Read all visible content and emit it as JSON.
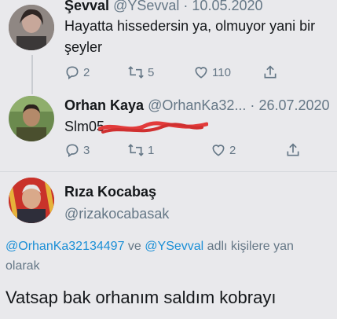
{
  "tweet1": {
    "name": "Şevval",
    "handle": "@YSevval",
    "separator": "·",
    "date": "10.05.2020",
    "text": "Hayatta hissedersin ya, olmuyor yani bir şeyler",
    "replies": "2",
    "retweets": "5",
    "likes": "110"
  },
  "tweet2": {
    "name": "Orhan Kaya",
    "handle": "@OrhanKa32...",
    "separator": "·",
    "date": "26.07.2020",
    "text_visible": "Slm05",
    "replies": "3",
    "retweets": "1",
    "likes": "2",
    "scribble_color": "#e23b3b"
  },
  "tweet3": {
    "name": "Rıza Kocabaş",
    "handle": "@rizakocabasak",
    "reply_mention1": "@OrhanKa32134497",
    "reply_conj": "ve",
    "reply_mention2": "@YSevval",
    "reply_suffix": "adlı kişilere yan",
    "reply_suffix2": "olarak",
    "text": "Vatsap bak orhanım saldım kobrayı"
  },
  "icons": {
    "reply": "reply-icon",
    "retweet": "retweet-icon",
    "like": "heart-icon",
    "share": "share-icon"
  },
  "colors": {
    "mention": "#1b8fd6",
    "muted": "#657786",
    "background": "#e9e9ec"
  }
}
